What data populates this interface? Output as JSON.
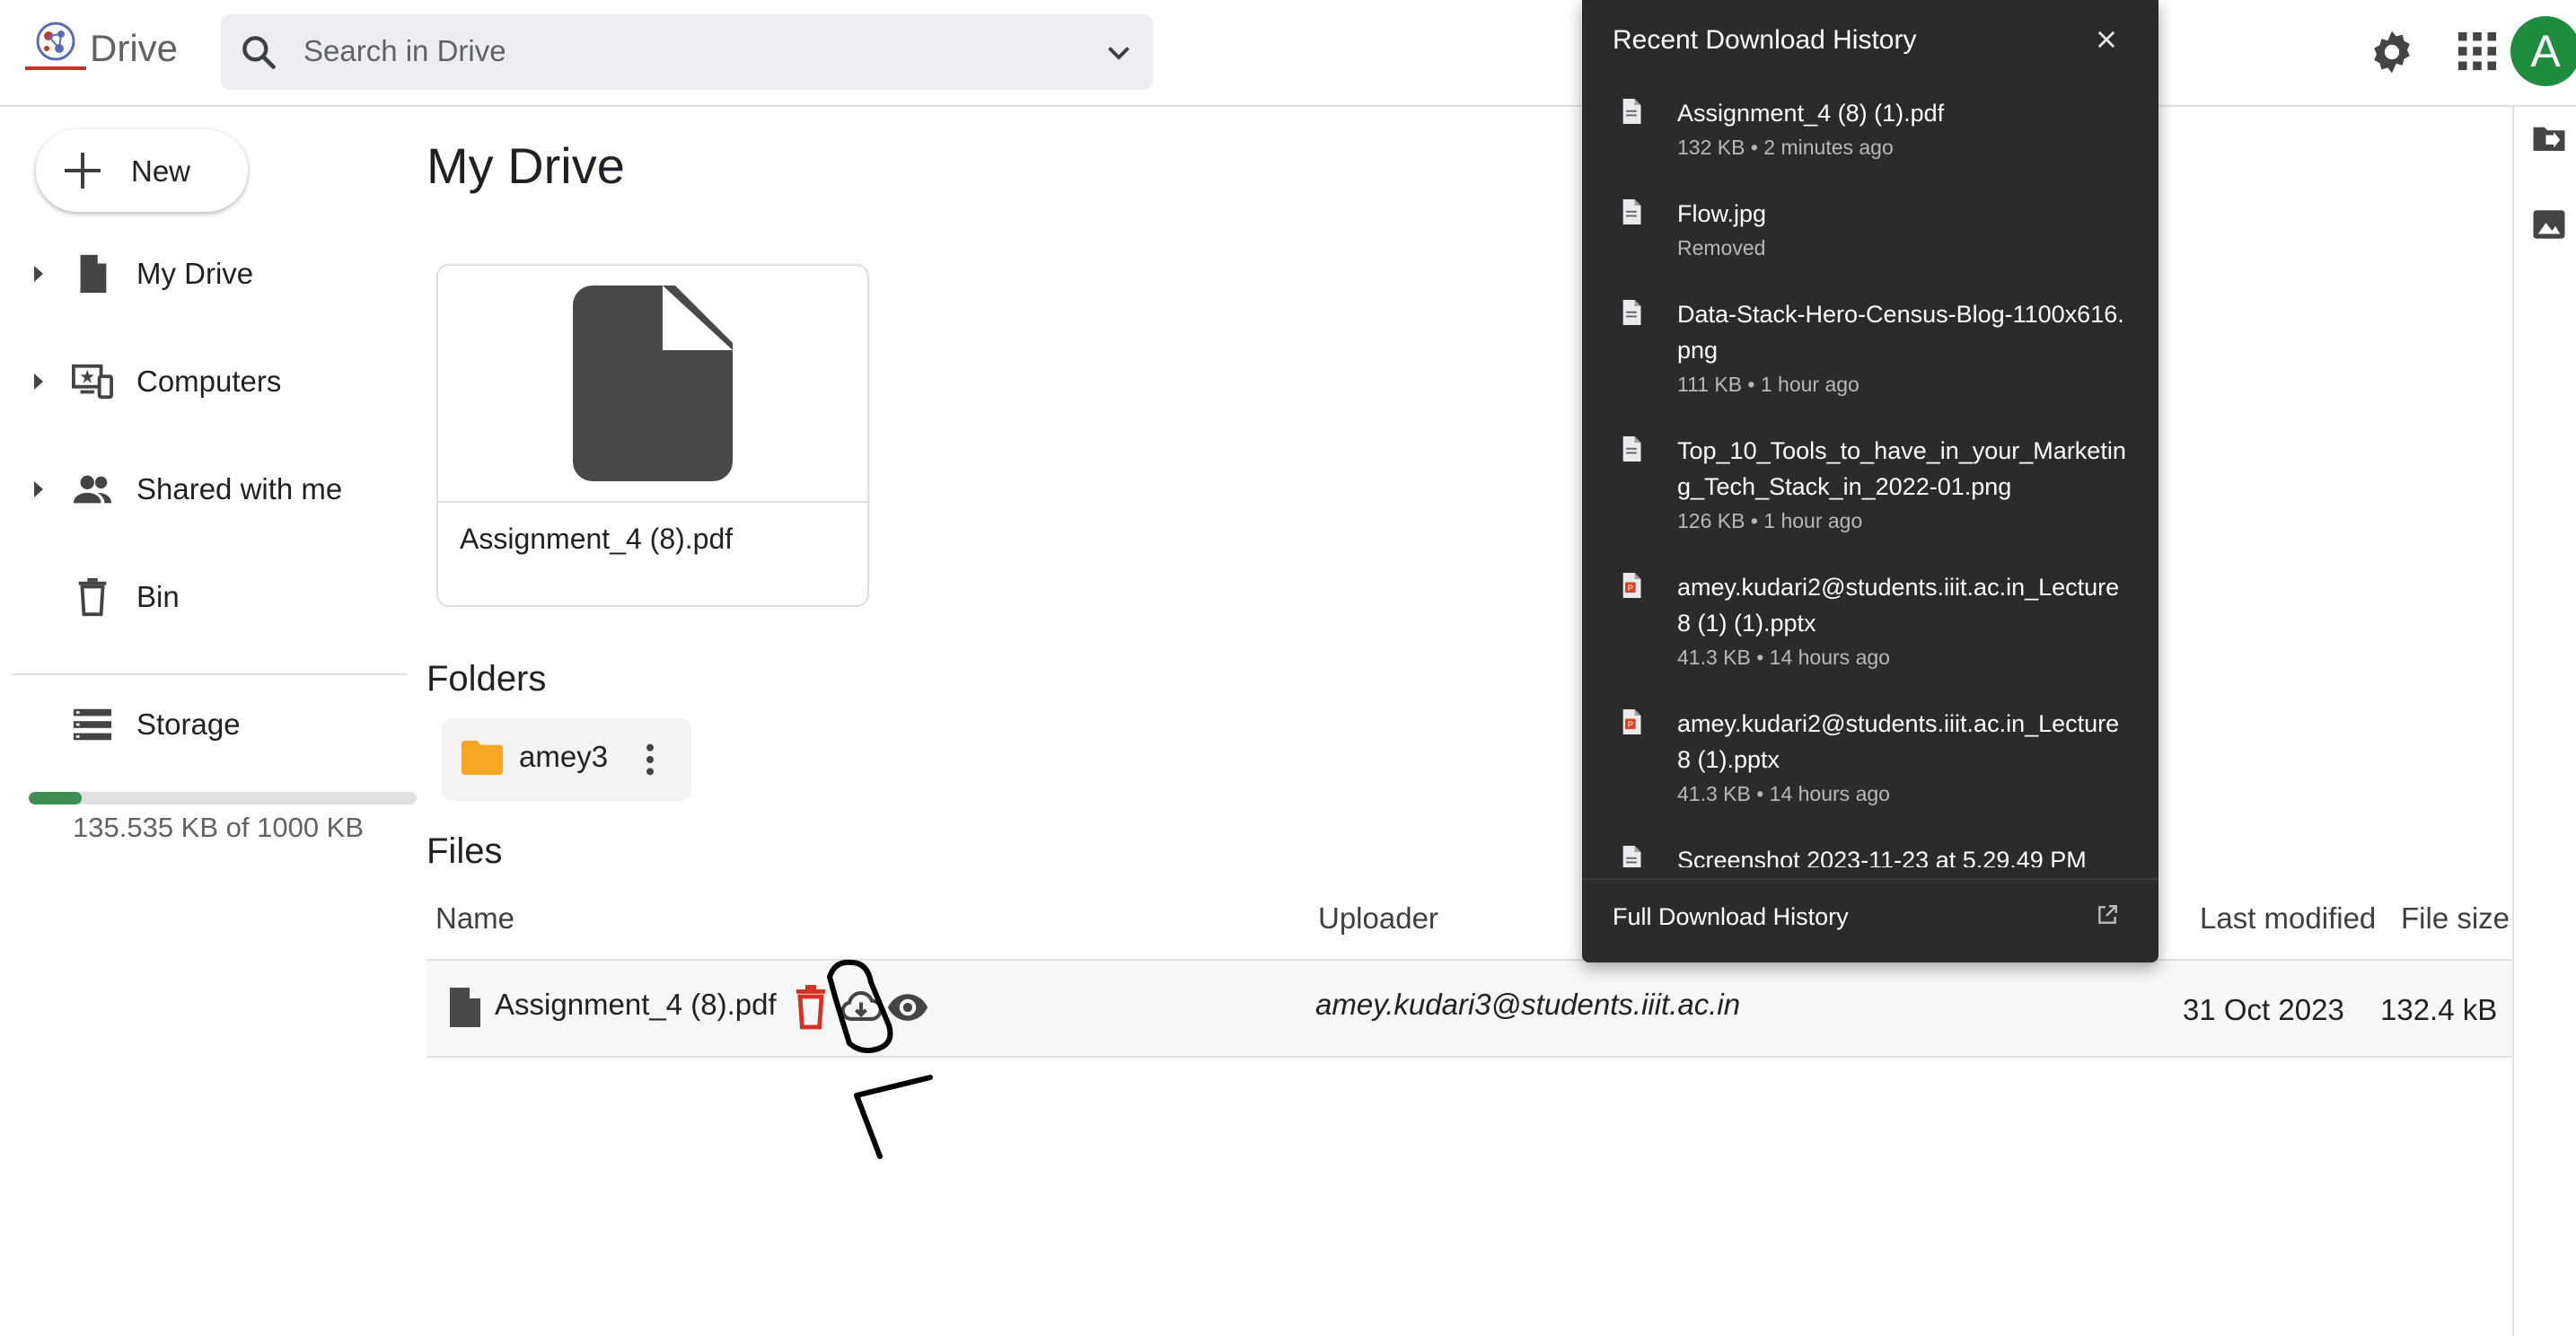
{
  "app": {
    "logo_text": "Drive",
    "avatar_letter": "A"
  },
  "search": {
    "placeholder": "Search in Drive"
  },
  "sidebar": {
    "new_label": "New",
    "items": [
      {
        "label": "My Drive"
      },
      {
        "label": "Computers"
      },
      {
        "label": "Shared with me"
      },
      {
        "label": "Bin"
      },
      {
        "label": "Storage"
      }
    ],
    "storage_text": "135.535 KB of 1000 KB",
    "storage_fraction": 0.1355
  },
  "main": {
    "title": "My Drive",
    "suggested_file": "Assignment_4 (8).pdf",
    "folders_heading": "Folders",
    "folders": [
      {
        "name": "amey3"
      }
    ],
    "files_heading": "Files",
    "columns": {
      "name": "Name",
      "uploader": "Uploader",
      "modified": "Last modified",
      "size": "File size"
    },
    "rows": [
      {
        "name": "Assignment_4 (8).pdf",
        "uploader": "amey.kudari3@students.iiit.ac.in",
        "modified": "31 Oct 2023",
        "size": "132.4 kB"
      }
    ]
  },
  "download_panel": {
    "title": "Recent Download History",
    "items": [
      {
        "name": "Assignment_4 (8) (1).pdf",
        "meta": "132 KB • 2 minutes ago",
        "icon": "doc-icon"
      },
      {
        "name": "Flow.jpg",
        "meta": "Removed",
        "icon": "doc-icon"
      },
      {
        "name": "Data-Stack-Hero-Census-Blog-1100x616.png",
        "meta": "111 KB • 1 hour ago",
        "icon": "doc-icon"
      },
      {
        "name": "Top_10_Tools_to_have_in_your_Marketing_Tech_Stack_in_2022-01.png",
        "meta": "126 KB • 1 hour ago",
        "icon": "doc-icon"
      },
      {
        "name": "amey.kudari2@students.iiit.ac.in_Lecture 8 (1) (1).pptx",
        "meta": "41.3 KB • 14 hours ago",
        "icon": "ppt-icon"
      },
      {
        "name": "amey.kudari2@students.iiit.ac.in_Lecture 8 (1).pptx",
        "meta": "41.3 KB • 14 hours ago",
        "icon": "ppt-icon"
      },
      {
        "name": "Screenshot 2023-11-23 at 5.29.49 PM",
        "meta": "",
        "icon": "doc-icon"
      }
    ],
    "footer_label": "Full Download History"
  },
  "colors": {
    "accent_green": "#1e8e3e",
    "delete_red": "#d93025",
    "panel_bg": "#2b2b2d"
  }
}
